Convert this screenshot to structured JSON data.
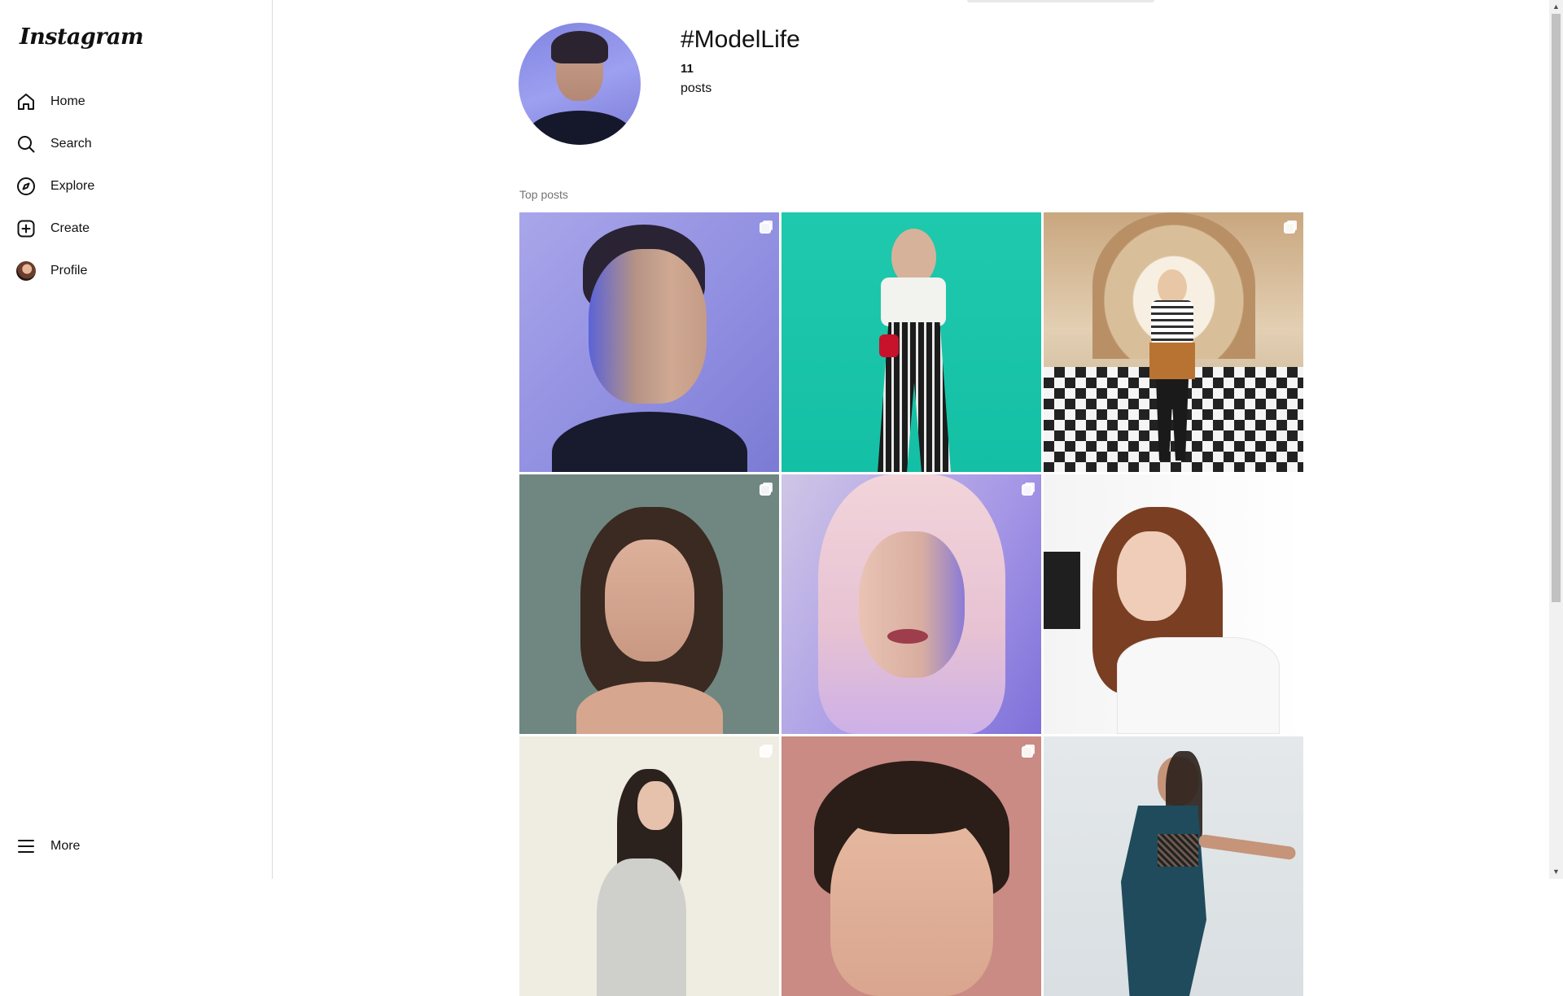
{
  "app": {
    "logo": "Instagram"
  },
  "sidebar": {
    "items": [
      {
        "label": "Home",
        "icon": "home-icon"
      },
      {
        "label": "Search",
        "icon": "search-icon"
      },
      {
        "label": "Explore",
        "icon": "compass-icon"
      },
      {
        "label": "Create",
        "icon": "plus-square-icon"
      },
      {
        "label": "Profile",
        "icon": "avatar"
      }
    ],
    "more": {
      "label": "More",
      "icon": "menu-icon"
    }
  },
  "hashtag": {
    "title": "#ModelLife",
    "count": "11",
    "count_label": "posts"
  },
  "section": {
    "top_posts_label": "Top posts"
  },
  "posts": [
    {
      "multi": true
    },
    {
      "multi": false
    },
    {
      "multi": true
    },
    {
      "multi": true
    },
    {
      "multi": true
    },
    {
      "multi": false
    },
    {
      "multi": true
    },
    {
      "multi": true
    },
    {
      "multi": false
    }
  ]
}
